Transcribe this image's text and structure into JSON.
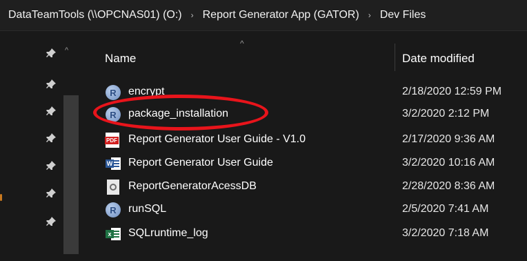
{
  "address_bar": {
    "crumbs": [
      "DataTeamTools (\\\\OPCNAS01) (O:)",
      "Report Generator App (GATOR)",
      "Dev Files"
    ],
    "separator": "›"
  },
  "columns": {
    "name": "Name",
    "date_modified": "Date modified",
    "sort_indicator": "^"
  },
  "nav_pane": {
    "pin_icon": "pin-icon",
    "scroll_up": "^",
    "pin_count": 7
  },
  "files": [
    {
      "name": "encrypt",
      "date": "2/18/2020 12:59 PM",
      "icon": "r-script-icon"
    },
    {
      "name": "package_installation",
      "date": "3/2/2020 2:12 PM",
      "icon": "r-script-icon"
    },
    {
      "name": "Report Generator User Guide - V1.0",
      "date": "2/17/2020 9:36 AM",
      "icon": "pdf-icon"
    },
    {
      "name": "Report Generator User Guide",
      "date": "3/2/2020 10:16 AM",
      "icon": "word-doc-icon"
    },
    {
      "name": "ReportGeneratorAcessDB",
      "date": "2/28/2020 8:36 AM",
      "icon": "access-db-icon"
    },
    {
      "name": "runSQL",
      "date": "2/5/2020 7:41 AM",
      "icon": "r-script-icon"
    },
    {
      "name": "SQLruntime_log",
      "date": "3/2/2020 7:18 AM",
      "icon": "excel-icon"
    }
  ],
  "colors": {
    "background": "#191919",
    "highlight": "#e8141b",
    "text": "#ffffff"
  }
}
